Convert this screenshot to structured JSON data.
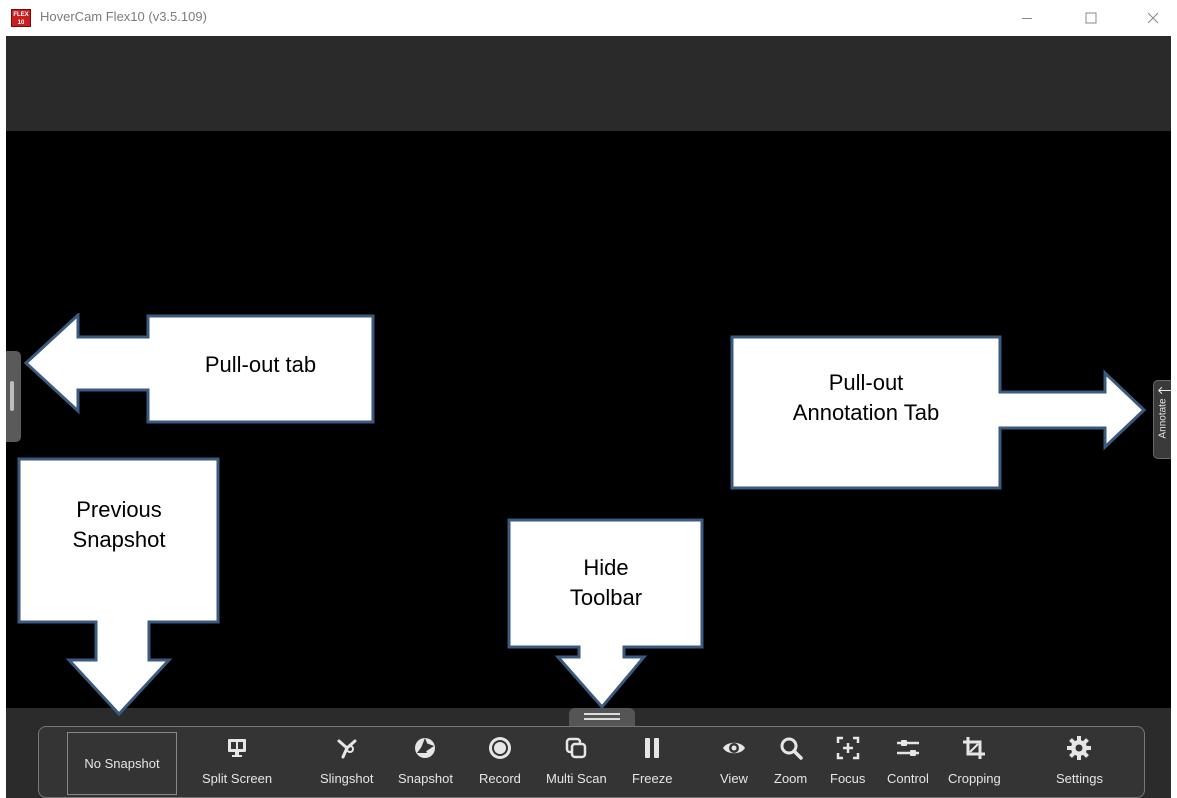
{
  "window": {
    "logo_text": "FLEX 10",
    "title": "HoverCam Flex10 (v3.5.109)"
  },
  "callouts": {
    "pullout_tab": "Pull-out tab",
    "annotation_tab_line1": "Pull-out",
    "annotation_tab_line2": "Annotation Tab",
    "previous_snapshot_line1": "Previous",
    "previous_snapshot_line2": "Snapshot",
    "hide_toolbar_line1": "Hide",
    "hide_toolbar_line2": "Toolbar"
  },
  "annotate_tab": {
    "label": "Annotate"
  },
  "toolbar": {
    "snapshot_placeholder": "No Snapshot",
    "items": [
      {
        "label": "Split Screen",
        "icon": "monitor-icon"
      },
      {
        "label": "Slingshot",
        "icon": "slingshot-icon"
      },
      {
        "label": "Snapshot",
        "icon": "aperture-icon"
      },
      {
        "label": "Record",
        "icon": "record-icon"
      },
      {
        "label": "Multi Scan",
        "icon": "multi-scan-icon"
      },
      {
        "label": "Freeze",
        "icon": "pause-icon"
      },
      {
        "label": "View",
        "icon": "eye-icon"
      },
      {
        "label": "Zoom",
        "icon": "magnifier-icon"
      },
      {
        "label": "Focus",
        "icon": "focus-icon"
      },
      {
        "label": "Control",
        "icon": "sliders-icon"
      },
      {
        "label": "Cropping",
        "icon": "crop-icon"
      },
      {
        "label": "Settings",
        "icon": "gear-icon"
      }
    ]
  },
  "colors": {
    "callout_fill": "#ffffff",
    "callout_border": "#3a5a80",
    "toolbar_bg": "#343434",
    "frame_bg": "#000000",
    "top_band_bg": "#2a2a2a"
  }
}
